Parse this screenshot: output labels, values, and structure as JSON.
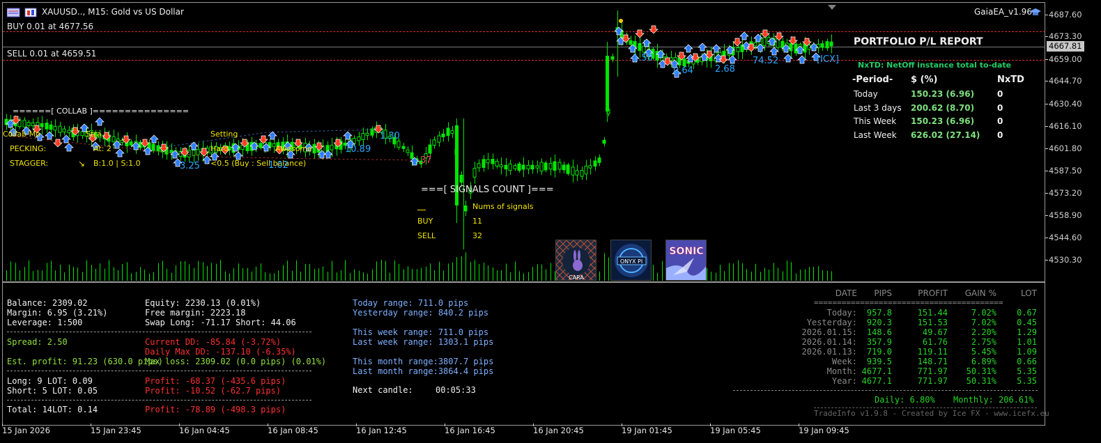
{
  "header": {
    "symbol": "XAUUSD.., M15:  Gold vs US Dollar",
    "ea_label": "GaiaEA_v1.96"
  },
  "trade_lines": {
    "buy_label": "BUY 0.01 at 4677.56",
    "sell_label": "SELL 0.01 at 4659.51"
  },
  "price_axis": {
    "ticks": [
      "4687.60",
      "4673.30",
      "4659.00",
      "4644.70",
      "4630.40",
      "4616.10",
      "4601.80",
      "4587.50",
      "4573.20",
      "4558.90",
      "4544.60",
      "4530.30"
    ],
    "current_price": "4667.81"
  },
  "time_axis": {
    "ticks": [
      "15 Jan 2026",
      "15 Jan 23:45",
      "16 Jan 04:45",
      "16 Jan 08:45",
      "16 Jan 12:45",
      "16 Jan 16:45",
      "16 Jan 20:45",
      "19 Jan 01:45",
      "19 Jan 05:45",
      "19 Jan 09:45"
    ]
  },
  "collab": {
    "title": "======[ COLLAB ]===============",
    "mode_label": "Collab Mo",
    "strategy_label": "Stra",
    "setting_label": "Setting",
    "pecking_label": "PECKING:",
    "pecking_value": "At: 2",
    "stagger_label": "STAGGER:",
    "stagger_arrow": "↘",
    "stagger_value": "B:1.0 | S:1.0",
    "hard_text": "Hard",
    "awesome_text": "Awesome",
    "balance_text": "<0.5 (Buy : Sell balance)"
  },
  "chart_labels": [
    {
      "text": "3.25",
      "color": "#29a8ff"
    },
    {
      "text": "1.02",
      "color": "#29a8ff"
    },
    {
      "text": "10.89",
      "color": "#29a8ff"
    },
    {
      "text": "1.30",
      "color": "#29a8ff"
    },
    {
      "text": "37",
      "color": "#ff3b5c"
    },
    {
      "text": "1.50",
      "color": "#29a8ff"
    },
    {
      "text": "0.64",
      "color": "#29a8ff"
    },
    {
      "text": "2.68",
      "color": "#29a8ff"
    },
    {
      "text": "74.52",
      "color": "#29a8ff"
    },
    {
      "text": "[ICX]",
      "color": "#29a8ff"
    }
  ],
  "signals": {
    "title": "===[ SIGNALS COUNT ]===",
    "column_header": "Nums of signals",
    "rows": [
      {
        "label": "BUY",
        "value": "11"
      },
      {
        "label": "SELL",
        "value": "32"
      }
    ]
  },
  "ea_icons": [
    {
      "name": "CARA"
    },
    {
      "name": "ONYX PI"
    },
    {
      "name": "SONIC"
    }
  ],
  "portfolio": {
    "title": "PORTFOLIO P/L REPORT",
    "subtitle": "NxTD: NetOff instance total to-date",
    "headers": [
      "-Period-",
      "$ (%)",
      "NxTD"
    ],
    "rows": [
      {
        "period": "Today",
        "value": "150.23 (6.96)",
        "nxtd": "0"
      },
      {
        "period": "Last 3 days",
        "value": "200.62 (8.70)",
        "nxtd": "0"
      },
      {
        "period": "This Week",
        "value": "150.23 (6.96)",
        "nxtd": "0"
      },
      {
        "period": "Last Week",
        "value": "626.02 (27.14)",
        "nxtd": "0"
      }
    ]
  },
  "account": {
    "balance": "Balance:  2309.02",
    "margin": "Margin: 6.95  (3.21%)",
    "leverage": "Leverage: 1:500",
    "equity": "Equity:  2230.13  (0.01%)",
    "free_margin": "Free margin: 2223.18",
    "swap": "Swap  Long: -71.17  Short: 44.06",
    "spread": "Spread: 2.50",
    "est_profit": "Est. profit: 91.23  (630.0 pips)",
    "current_dd": "Current    DD: -85.84   (-3.72%)",
    "daily_max_dd": "Daily Max DD: -137.10   (-6.35%)",
    "max_loss": "Max loss:  2309.02  (0.0 pips)  (0.01%)",
    "long": "Long:  9  LOT: 0.09",
    "short": "Short: 5  LOT: 0.05",
    "long_profit": "Profit: -68.37   (-435.6 pips)",
    "short_profit": "Profit: -10.52   (-62.7 pips)",
    "total": "Total:  14LOT: 0.14",
    "total_profit": "Profit: -78.89   (-498.3 pips)"
  },
  "ranges": {
    "today": "Today range:       711.0 pips",
    "yesterday": "Yesterday range:  840.2 pips",
    "this_week": "This week range:  711.0 pips",
    "last_week": "Last week range:  1303.1 pips",
    "this_month": "This month range:3807.7 pips",
    "last_month": "Last month range:3864.4 pips",
    "next_candle_label": "Next candle:",
    "next_candle_value": "00:05:33"
  },
  "perf": {
    "headers": [
      "DATE",
      "PIPS",
      "PROFIT",
      "GAIN %",
      "LOT"
    ],
    "separator": "=========================================",
    "rows": [
      {
        "date": "Today:",
        "pips": "957.8",
        "profit": "151.44",
        "gain": "7.02%",
        "lot": "0.67"
      },
      {
        "date": "Yesterday:",
        "pips": "920.3",
        "profit": "151.53",
        "gain": "7.02%",
        "lot": "0.45"
      },
      {
        "date": "2026.01.15:",
        "pips": "148.6",
        "profit": "49.67",
        "gain": "2.20%",
        "lot": "1.29"
      },
      {
        "date": "2026.01.14:",
        "pips": "357.9",
        "profit": "61.76",
        "gain": "2.75%",
        "lot": "1.01"
      },
      {
        "date": "2026.01.13:",
        "pips": "719.0",
        "profit": "119.11",
        "gain": "5.45%",
        "lot": "1.09"
      },
      {
        "date": "Week:",
        "pips": "939.5",
        "profit": "148.71",
        "gain": "6.89%",
        "lot": "0.66"
      },
      {
        "date": "Month:",
        "pips": "4677.1",
        "profit": "771.97",
        "gain": "50.31%",
        "lot": "5.35"
      },
      {
        "date": "Year:",
        "pips": "4677.1",
        "profit": "771.97",
        "gain": "50.31%",
        "lot": "5.35"
      }
    ],
    "daily": "Daily: 6.80%",
    "monthly": "Monthly: 206.61%",
    "footer": "TradeInfo v1.9.8 - Created by Ice FX - www.icefx.eu"
  },
  "colors": {
    "background": "#000000",
    "candle_up": "#00e600",
    "buy_arrow": "#2f7dff",
    "sell_arrow": "#ff3b1f",
    "buy_line": "#e03030",
    "profit_green": "#28d428",
    "loss_red": "#ff3030"
  }
}
